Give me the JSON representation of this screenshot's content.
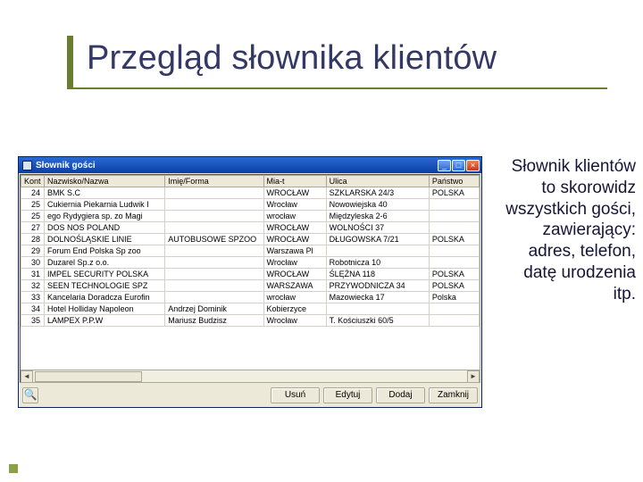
{
  "slide": {
    "title": "Przegląd słownika klientów"
  },
  "window": {
    "title": "Słownik gości",
    "columns": [
      "Kont",
      "Nazwisko/Nazwa",
      "Imię/Forma",
      "Mia-t",
      "Ulica",
      "Państwo"
    ],
    "rows": [
      {
        "id": "24",
        "name": "BMK S.C",
        "form": "",
        "city": "WROCŁAW",
        "street": "SZKLARSKA 24/3",
        "country": "POLSKA"
      },
      {
        "id": "25",
        "name": "Cukiernia Piekarnia Ludwik I",
        "form": "",
        "city": "Wrocław",
        "street": "Nowowiejska 40",
        "country": ""
      },
      {
        "id": "25",
        "name": "ego Rydygiera sp. zo Magi",
        "form": "",
        "city": "wrocław",
        "street": "Międzyleska 2-6",
        "country": ""
      },
      {
        "id": "27",
        "name": "DOS NOS POLAND",
        "form": "",
        "city": "WROCŁAW",
        "street": "WOLNOŚCI 37",
        "country": ""
      },
      {
        "id": "28",
        "name": "DOLNOŚLĄSKIE LINIE",
        "form": "AUTOBUSOWE SPZOO",
        "city": "WROCŁAW",
        "street": "DŁUGOWSKA 7/21",
        "country": "POLSKA"
      },
      {
        "id": "29",
        "name": "Forum End Polska Sp zoo",
        "form": "",
        "city": "Warszawa Pl",
        "street": "",
        "country": ""
      },
      {
        "id": "30",
        "name": "Duzarel Sp.z o.o.",
        "form": "",
        "city": "Wrocław",
        "street": "Robotnicza 10",
        "country": ""
      },
      {
        "id": "31",
        "name": "IMPEL SECURITY POLSKA",
        "form": "",
        "city": "WROCŁAW",
        "street": "ŚLĘŻNA 118",
        "country": "POLSKA"
      },
      {
        "id": "32",
        "name": "SEEN TECHNOLOGIE SPZ",
        "form": "",
        "city": "WARSZAWA",
        "street": "PRZYWODNICZA 34",
        "country": "POLSKA"
      },
      {
        "id": "33",
        "name": "Kancelaria Doradcza Eurofin",
        "form": "",
        "city": "wrocław",
        "street": "Mazowiecka 17",
        "country": "Polska"
      },
      {
        "id": "34",
        "name": "Hotel Holliday Napoleon",
        "form": "Andrzej Dominik",
        "city": "Kobierzyce",
        "street": "",
        "country": ""
      },
      {
        "id": "35",
        "name": "LAMPEX P.P.W",
        "form": "Mariusz Budzisz",
        "city": "Wrocław",
        "street": "T. Kościuszki 60/5",
        "country": ""
      }
    ],
    "buttons": {
      "search": "🔍",
      "delete": "Usuń",
      "edit": "Edytuj",
      "add": "Dodaj",
      "close": "Zamknij"
    }
  },
  "description": {
    "l1": "Słownik klientów",
    "l2": "to skorowidz",
    "l3": "wszystkich gości,",
    "l4": "zawierający:",
    "l5": "adres, telefon,",
    "l6": "datę urodzenia",
    "l7": "itp."
  }
}
